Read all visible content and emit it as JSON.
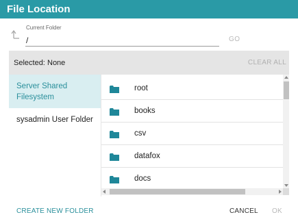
{
  "dialog": {
    "title": "File Location"
  },
  "current_folder": {
    "label": "Current Folder",
    "value": "/",
    "go_label": "GO"
  },
  "selection": {
    "label": "Selected:",
    "value": "None",
    "clear_all_label": "CLEAR ALL"
  },
  "sources": [
    {
      "label": "Server Shared Filesystem",
      "active": true
    },
    {
      "label": "sysadmin User Folder",
      "active": false
    }
  ],
  "folders": [
    {
      "name": "root",
      "icon": "folder-icon"
    },
    {
      "name": "books",
      "icon": "folder-icon"
    },
    {
      "name": "csv",
      "icon": "folder-icon"
    },
    {
      "name": "datafox",
      "icon": "folder-icon"
    },
    {
      "name": "docs",
      "icon": "folder-icon"
    }
  ],
  "footer": {
    "create_folder_label": "CREATE NEW FOLDER",
    "cancel_label": "CANCEL",
    "ok_label": "OK"
  },
  "colors": {
    "accent": "#2a9aa6",
    "accent_text": "#2a8f9b",
    "active_bg": "#d9eef1",
    "disabled_text": "#b8b8b8"
  }
}
